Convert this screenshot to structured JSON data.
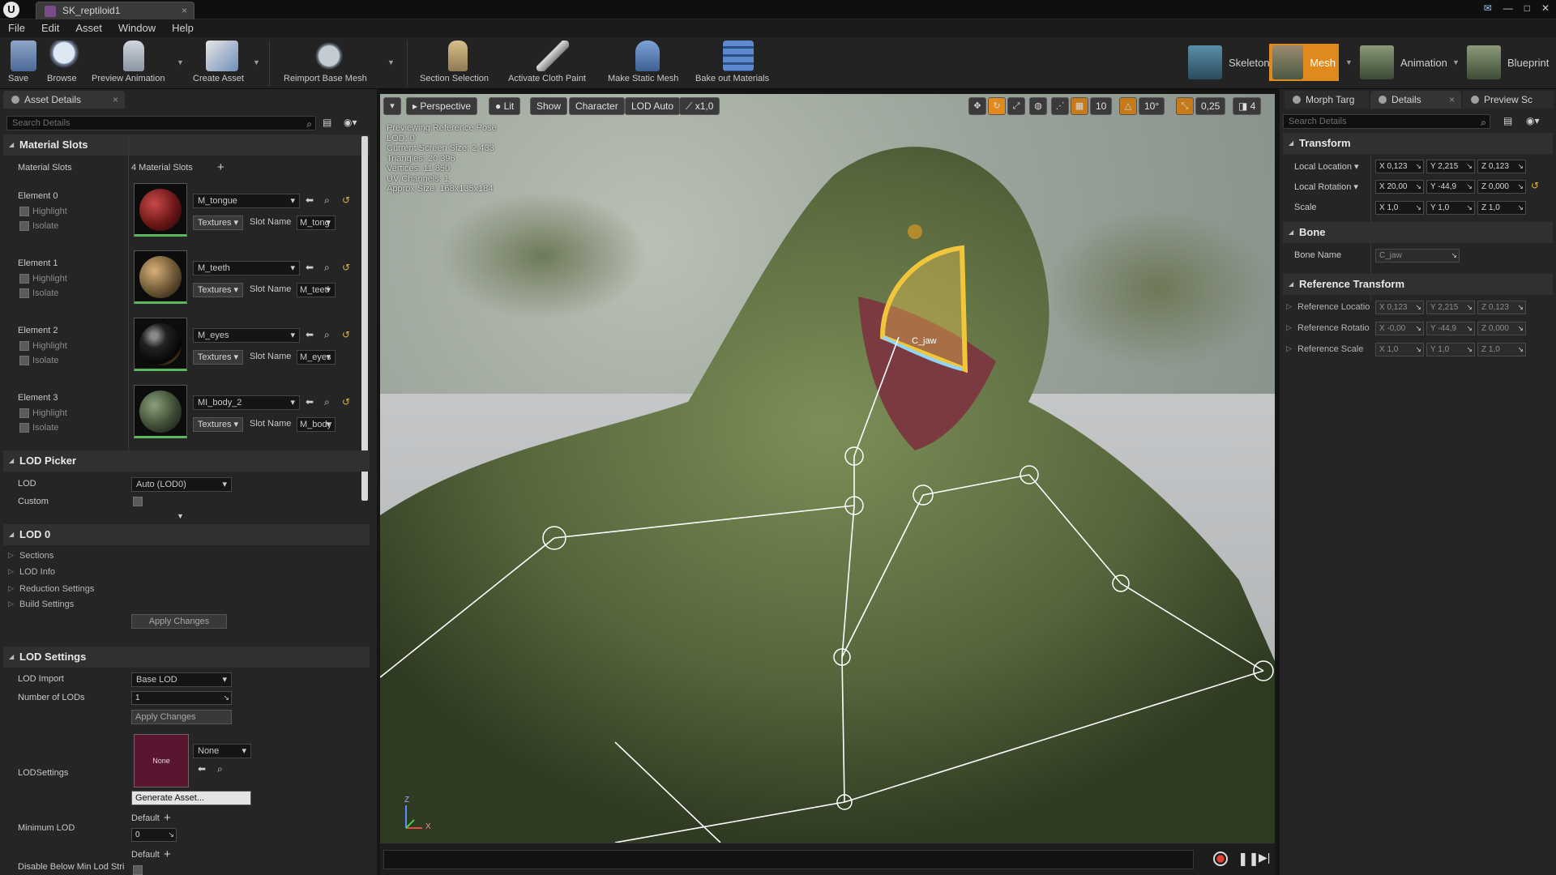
{
  "window": {
    "title": "SK_reptiloid1",
    "controls": [
      "—",
      "□",
      "✕"
    ]
  },
  "menu": [
    "File",
    "Edit",
    "Asset",
    "Window",
    "Help"
  ],
  "toolbar": {
    "buttons": [
      {
        "label": "Save",
        "icon": "save-icon"
      },
      {
        "label": "Browse",
        "icon": "browse-icon"
      },
      {
        "label": "Preview Animation",
        "icon": "preview-animation-icon"
      },
      {
        "label": "Create Asset",
        "icon": "create-asset-icon"
      },
      {
        "label": "Reimport Base Mesh",
        "icon": "reimport-icon"
      },
      {
        "label": "Section Selection",
        "icon": "section-selection-icon"
      },
      {
        "label": "Activate Cloth Paint",
        "icon": "cloth-paint-icon"
      },
      {
        "label": "Make Static Mesh",
        "icon": "static-mesh-icon"
      },
      {
        "label": "Bake out Materials",
        "icon": "bake-materials-icon"
      }
    ],
    "modes": [
      {
        "label": "Skeleton",
        "active": false
      },
      {
        "label": "Mesh",
        "active": true
      },
      {
        "label": "Animation",
        "active": false
      },
      {
        "label": "Blueprint",
        "active": false
      }
    ]
  },
  "left_panel": {
    "tab": "Asset Details",
    "search_placeholder": "Search Details",
    "material_slots": {
      "header": "Material Slots",
      "row_label": "Material Slots",
      "count": "4 Material Slots",
      "elements": [
        {
          "label": "Element 0",
          "material": "M_tongue",
          "slot_name": "M_tong",
          "ball_color": "#6b1616"
        },
        {
          "label": "Element 1",
          "material": "M_teeth",
          "slot_name": "M_teetl",
          "ball_color": "#6a5534"
        },
        {
          "label": "Element 2",
          "material": "M_eyes",
          "slot_name": "M_eyes",
          "ball_color": "#222"
        },
        {
          "label": "Element 3",
          "material": "MI_body_2",
          "slot_name": "M_body",
          "ball_color": "#3d4a35"
        }
      ],
      "highlight": "Highlight",
      "isolate": "Isolate",
      "textures": "Textures",
      "slot_name_label": "Slot Name"
    },
    "lod_picker": {
      "header": "LOD Picker",
      "lod_label": "LOD",
      "lod_value": "Auto (LOD0)",
      "custom_label": "Custom"
    },
    "lod0": {
      "header": "LOD 0",
      "subs": [
        "Sections",
        "LOD Info",
        "Reduction Settings",
        "Build Settings"
      ],
      "apply": "Apply Changes"
    },
    "lod_settings": {
      "header": "LOD Settings",
      "lod_import_label": "LOD Import",
      "lod_import_value": "Base LOD",
      "num_lods_label": "Number of LODs",
      "num_lods_value": "1",
      "apply": "Apply Changes",
      "lodsettings_label": "LODSettings",
      "none_thumb": "None",
      "none_combo": "None",
      "generate": "Generate Asset...",
      "min_lod_label": "Minimum LOD",
      "default1": "Default",
      "min_lod_value": "0",
      "disable_label": "Disable Below Min Lod Stri",
      "default2": "Default"
    }
  },
  "viewport": {
    "buttons": {
      "perspective": "Perspective",
      "lit": "Lit",
      "show": "Show",
      "character": "Character",
      "lod": "LOD Auto",
      "speed": "x1,0"
    },
    "right_icons": {
      "grid": "10",
      "angle": "10°",
      "scale": "0,25",
      "cam": "4"
    },
    "info": [
      "Previewing Reference Pose",
      "LOD: 0",
      "Current Screen Size: 2,433",
      "Triangles: 20 396",
      "Vertices: 11 850",
      "UV Channels: 1",
      "Approx Size: 168x135x184"
    ],
    "bone_label": "C_jaw",
    "axis": {
      "z": "Z",
      "x": "X"
    }
  },
  "right_panel": {
    "tabs": [
      "Morph Targ",
      "Details",
      "Preview Sc"
    ],
    "search_placeholder": "Search Details",
    "transform": {
      "header": "Transform",
      "rows": [
        {
          "label": "Local Location",
          "dd": true,
          "x": "X 0,123",
          "y": "Y 2,215",
          "z": "Z 0,123"
        },
        {
          "label": "Local Rotation",
          "dd": true,
          "x": "X 20,00",
          "y": "Y -44,9",
          "z": "Z 0,000"
        },
        {
          "label": "Scale",
          "dd": false,
          "x": "X 1,0",
          "y": "Y 1,0",
          "z": "Z 1,0"
        }
      ]
    },
    "bone": {
      "header": "Bone",
      "label": "Bone Name",
      "value": "C_jaw"
    },
    "ref": {
      "header": "Reference Transform",
      "rows": [
        {
          "label": "Reference Locatio",
          "x": "X 0,123",
          "y": "Y 2,215",
          "z": "Z 0,123"
        },
        {
          "label": "Reference Rotatio",
          "x": "X -0,00",
          "y": "Y -44,9",
          "z": "Z 0,000"
        },
        {
          "label": "Reference Scale",
          "x": "X 1,0",
          "y": "Y 1,0",
          "z": "Z 1,0"
        }
      ]
    }
  },
  "colors": {
    "accent": "#e08a1e",
    "green_underline": "#5cb85c"
  }
}
